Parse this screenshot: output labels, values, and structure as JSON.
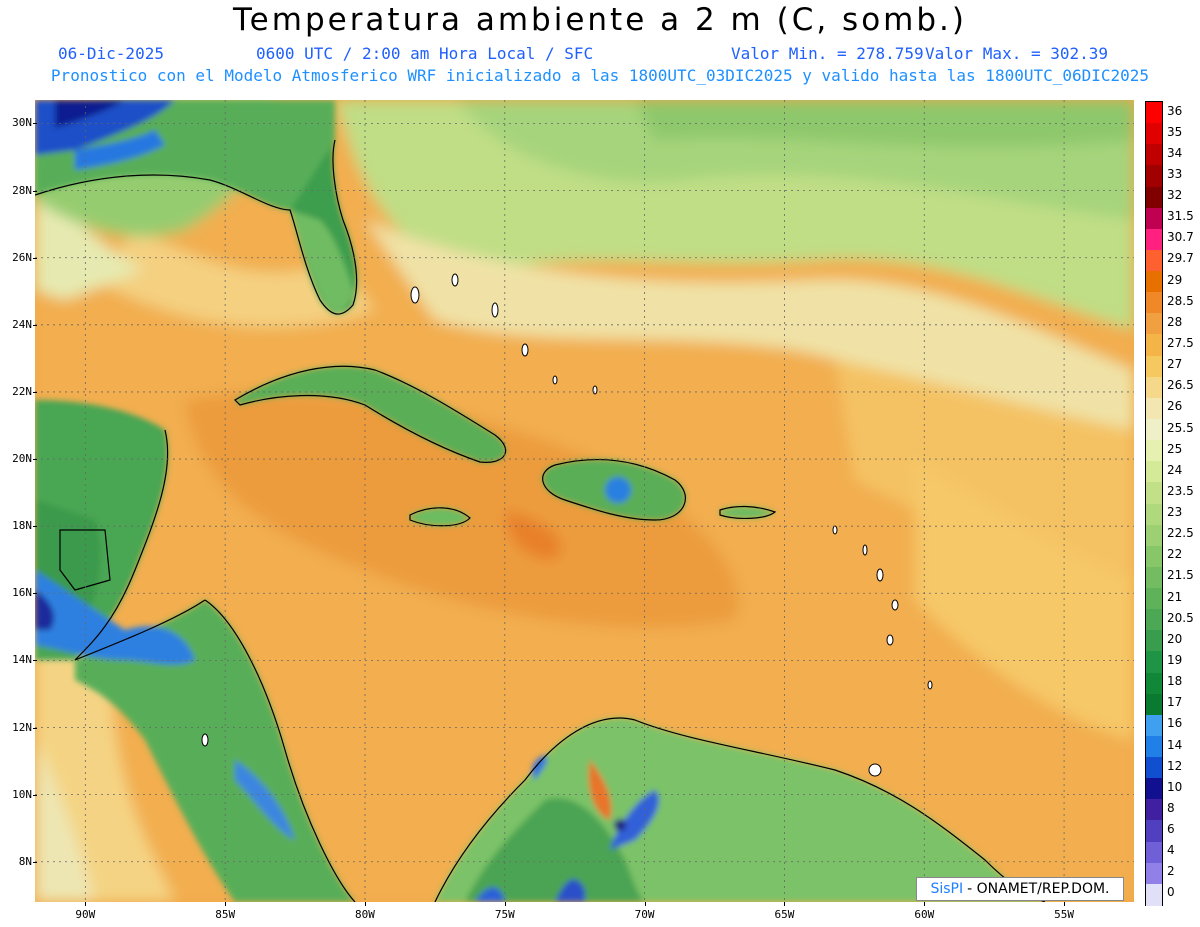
{
  "header": {
    "title": "Temperatura ambiente a 2 m (C, somb.)",
    "date": "06-Dic-2025",
    "time": "0600 UTC / 2:00 am Hora Local / SFC",
    "min": "Valor Min. = 278.759",
    "max": "Valor Max. = 302.39",
    "forecast": "Pronostico con el Modelo Atmosferico WRF inicializado a las 1800UTC_03DIC2025 y valido hasta las  1800UTC_06DIC2025"
  },
  "map": {
    "lat_labels": [
      "30N",
      "28N",
      "26N",
      "24N",
      "22N",
      "20N",
      "18N",
      "16N",
      "14N",
      "12N",
      "10N",
      "8N"
    ],
    "lon_labels": [
      "90W",
      "85W",
      "80W",
      "75W",
      "70W",
      "65W",
      "60W",
      "55W"
    ],
    "lat_values": [
      30,
      28,
      26,
      24,
      22,
      20,
      18,
      16,
      14,
      12,
      10,
      8
    ],
    "lon_values": [
      -90,
      -85,
      -80,
      -75,
      -70,
      -65,
      -60,
      -55
    ],
    "lat_range": [
      6.8,
      30.7
    ],
    "lon_range": [
      -91.8,
      -52.5
    ],
    "grid": true
  },
  "colorbar": {
    "labels": [
      "36",
      "35",
      "34",
      "33",
      "32",
      "31.5",
      "30.7",
      "29.7",
      "29",
      "28.5",
      "28",
      "27.5",
      "27",
      "26.5",
      "26",
      "25.5",
      "25",
      "24",
      "23.5",
      "23",
      "22.5",
      "22",
      "21.5",
      "21",
      "20.5",
      "20",
      "19",
      "18",
      "17",
      "16",
      "14",
      "12",
      "10",
      "8",
      "6",
      "4",
      "2",
      "0"
    ],
    "colors": [
      "#ff0000",
      "#e00000",
      "#c00000",
      "#a00000",
      "#800000",
      "#c00050",
      "#ff2080",
      "#ff6030",
      "#e87000",
      "#f08828",
      "#f0a040",
      "#f4b448",
      "#f6c860",
      "#f6d88a",
      "#f4e6b0",
      "#f0f0c8",
      "#e6f0b0",
      "#d4ea98",
      "#c2e088",
      "#b0d87c",
      "#9cd072",
      "#88c66a",
      "#74bc62",
      "#60b25a",
      "#4ca854",
      "#389e4e",
      "#1e9444",
      "#108838",
      "#0a7a30",
      "#40a0f0",
      "#2080e8",
      "#1050d0",
      "#101090",
      "#4020a0",
      "#5040c0",
      "#7060d8",
      "#9080e8",
      "#e0e0f8"
    ]
  },
  "credit": {
    "brand": "SisPI",
    "rest": "- ONAMET/REP.DOM."
  }
}
